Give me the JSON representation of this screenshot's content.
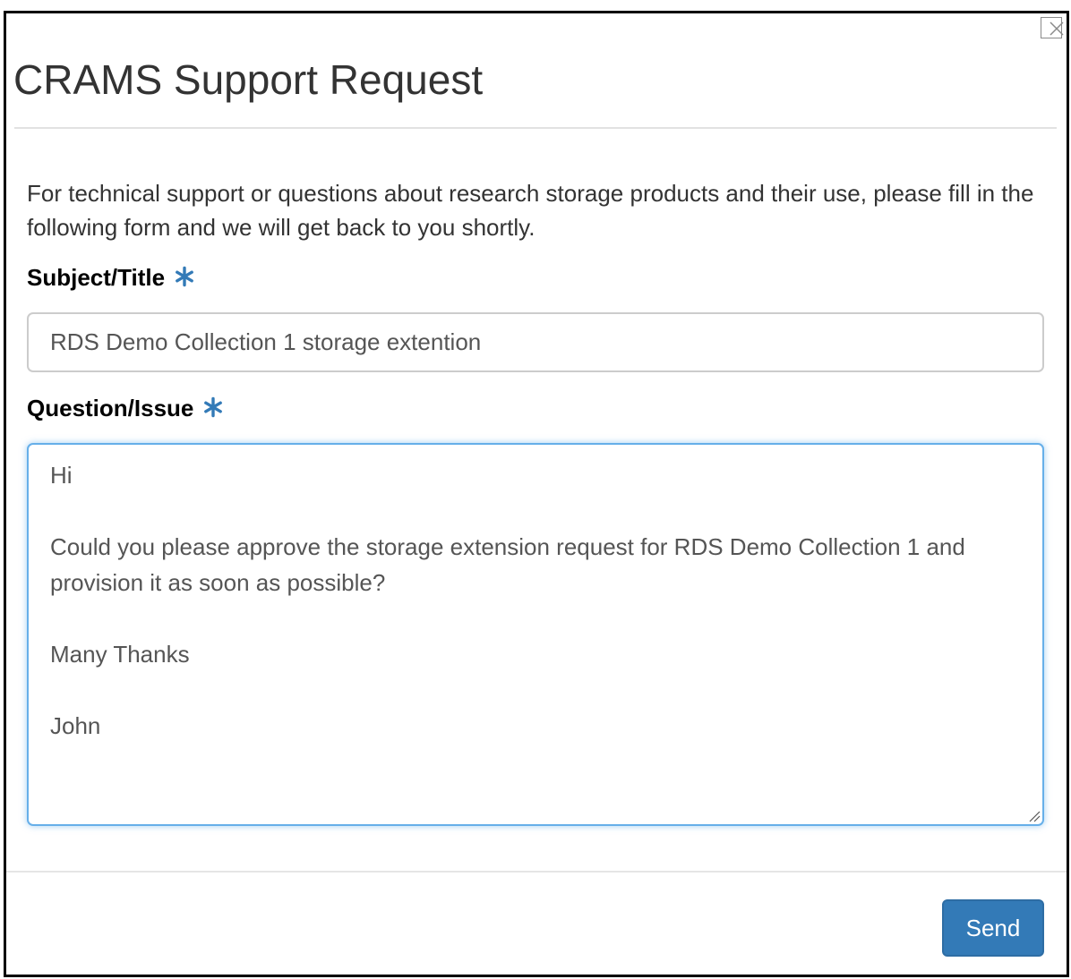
{
  "dialog": {
    "title": "CRAMS Support Request",
    "intro": "For technical support or questions about research storage products and their use, please fill in the following form and we will get back to you shortly.",
    "close_icon": "close-icon"
  },
  "form": {
    "subject_label": "Subject/Title",
    "subject_value": "RDS Demo Collection 1 storage extention",
    "question_label": "Question/Issue",
    "question_value": "Hi\n\nCould you please approve the storage extension request for RDS Demo Collection 1 and provision it as soon as possible?\n\nMany Thanks\n\nJohn",
    "required_icon": "asterisk-icon",
    "required_color": "#337ab7"
  },
  "footer": {
    "send_label": "Send",
    "send_color": "#337ab7"
  }
}
